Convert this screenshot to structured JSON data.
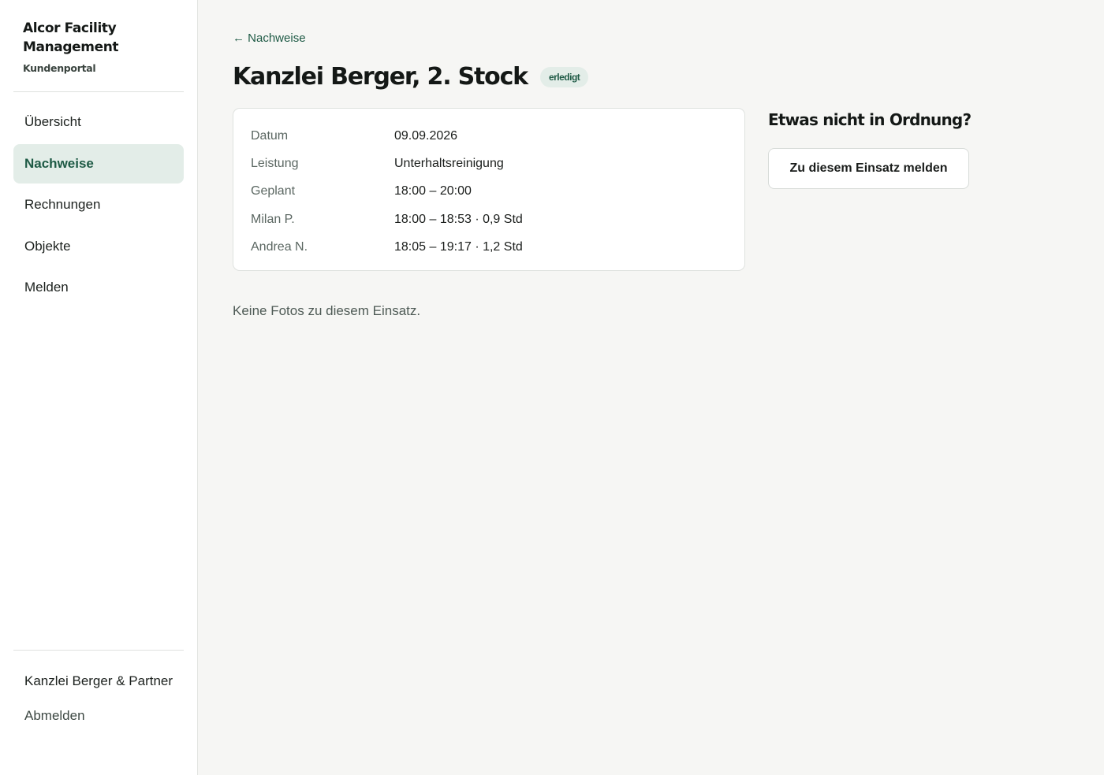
{
  "brand": {
    "name": "Alcor Facility Management",
    "subtitle": "Kundenportal"
  },
  "nav": {
    "items": [
      {
        "label": "Übersicht",
        "active": false
      },
      {
        "label": "Nachweise",
        "active": true
      },
      {
        "label": "Rechnungen",
        "active": false
      },
      {
        "label": "Objekte",
        "active": false
      },
      {
        "label": "Melden",
        "active": false
      }
    ]
  },
  "account": {
    "name": "Kanzlei Berger & Partner",
    "logout_label": "Abmelden"
  },
  "page": {
    "back_label": "← Nachweise",
    "title": "Kanzlei Berger, 2. Stock",
    "status": "erledigt",
    "details": [
      {
        "label": "Datum",
        "value": "09.09.2026"
      },
      {
        "label": "Leistung",
        "value": "Unterhaltsreinigung"
      },
      {
        "label": "Geplant",
        "value": "18:00 – 20:00"
      },
      {
        "label": "Milan P.",
        "value": "18:00 – 18:53 · 0,9 Std"
      },
      {
        "label": "Andrea N.",
        "value": "18:05 – 19:17 · 1,2 Std"
      }
    ],
    "empty_photos": "Keine Fotos zu diesem Einsatz."
  },
  "report": {
    "title": "Etwas nicht in Ordnung?",
    "button_label": "Zu diesem Einsatz melden"
  },
  "colors": {
    "accent": "#1e5a45",
    "accent_bg": "#e3ede8",
    "page_bg": "#f6f6f4"
  }
}
